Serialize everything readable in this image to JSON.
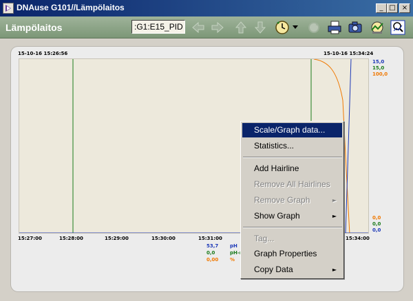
{
  "window": {
    "title": "DNAuse G101//Lämpölaitos",
    "minimize": "_",
    "maximize": "□",
    "close": "×"
  },
  "toolbar": {
    "title": "Lämpölaitos",
    "point_value": ":G1:E15_PID"
  },
  "graph": {
    "start_time": "15-10-16 15:26:56",
    "end_time": "15-10-16 15:34:24",
    "x_ticks": [
      "15:27:00",
      "15:28:00",
      "15:29:00",
      "15:30:00",
      "15:31:00",
      "15:34:00"
    ],
    "right_top": [
      "15,0",
      "15,0",
      "100,0"
    ],
    "right_bottom": [
      "0,0",
      "0,0",
      "0,0"
    ],
    "legend": [
      {
        "value": "53,7",
        "name": "pH",
        "color": "#1c38b8"
      },
      {
        "value": "0,0",
        "name": "pH-r",
        "color": "#1a7a1a"
      },
      {
        "value": "0,00",
        "name": "%",
        "color": "#f07800"
      }
    ],
    "colors": {
      "blue": "#1c38b8",
      "green": "#1a7a1a",
      "orange": "#f07800"
    }
  },
  "context_menu": {
    "items": [
      {
        "label": "Scale/Graph data...",
        "state": "selected"
      },
      {
        "label": "Statistics...",
        "state": "enabled"
      },
      {
        "label": "Add Hairline",
        "state": "enabled"
      },
      {
        "label": "Remove All Hairlines",
        "state": "disabled"
      },
      {
        "label": "Remove Graph",
        "state": "disabled",
        "submenu": "►"
      },
      {
        "label": "Show Graph",
        "state": "enabled",
        "submenu": "►"
      },
      {
        "label": "Tag...",
        "state": "disabled"
      },
      {
        "label": "Graph Properties",
        "state": "enabled"
      },
      {
        "label": "Copy Data",
        "state": "enabled",
        "submenu": "►"
      }
    ]
  },
  "icons": [
    "app-icon",
    "back-arrow-icon",
    "forward-arrow-icon",
    "up-arrow-icon",
    "down-arrow-icon",
    "clock-icon",
    "dropdown-icon",
    "refresh-icon",
    "print-icon",
    "camera-icon",
    "graph-settings-icon",
    "zoom-icon"
  ]
}
